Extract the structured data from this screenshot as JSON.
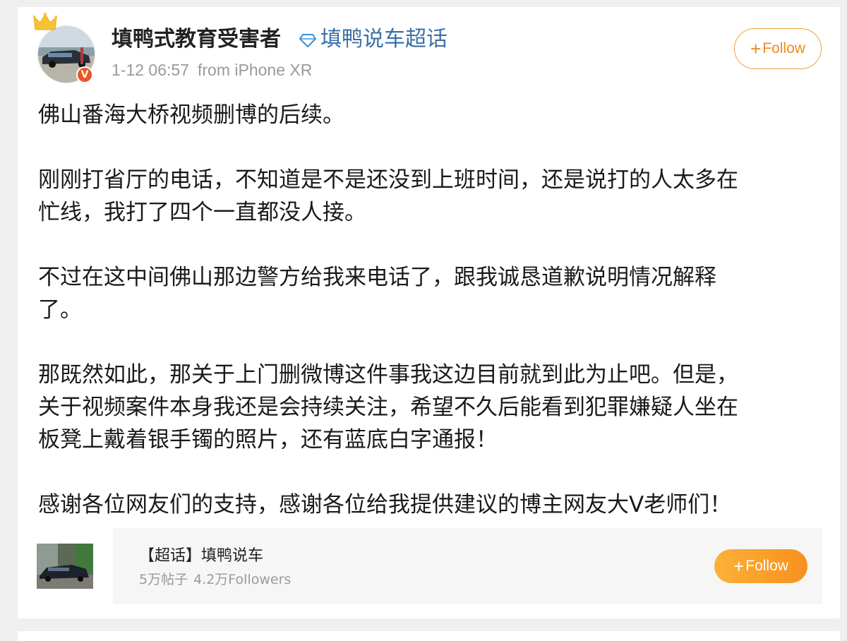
{
  "post": {
    "username": "填鸭式教育受害者",
    "topic_link": "填鸭说车超话",
    "time": "1-12 06:57",
    "source": "from iPhone XR",
    "follow_label": "Follow",
    "paragraphs": [
      "佛山番海大桥视频删博的后续。",
      "刚刚打省厅的电话，不知道是不是还没到上班时间，还是说打的人太多在\n忙线，我打了四个一直都没人接。",
      "不过在这中间佛山那边警方给我来电话了，跟我诚恳道歉说明情况解释\n了。",
      "那既然如此，那关于上门删微博这件事我这边目前就到此为止吧。但是，\n关于视频案件本身我还是会持续关注，希望不久后能看到犯罪嫌疑人坐在\n板凳上戴着银手镯的照片，还有蓝底白字通报！",
      "感谢各位网友们的支持，感谢各位给我提供建议的博主网友大Ⅴ老师们！"
    ]
  },
  "topic_card": {
    "title": "【超话】填鸭说车",
    "posts": "5万帖子",
    "followers": "4.2万Followers",
    "follow_label": "Follow"
  },
  "badges": {
    "verified": "V"
  },
  "icons": {
    "crown": "crown-icon",
    "diamond": "diamond-icon",
    "plus": "plus-icon"
  },
  "colors": {
    "accent_orange": "#f08a1d",
    "link_blue": "#3b6fa8",
    "verified_red": "#e9542e",
    "crown_gold": "#f6c333"
  }
}
